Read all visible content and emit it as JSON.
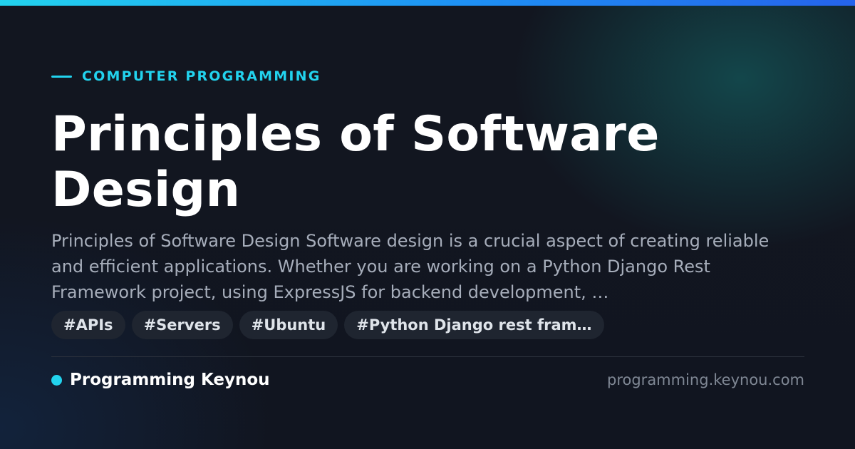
{
  "colors": {
    "background": "#121620",
    "accent": "#22d3ee",
    "accent_blue": "#2563eb",
    "title": "#ffffff",
    "description": "#a6adba",
    "tag_bg": "#1f2530",
    "tag_text": "#dfe4ea",
    "domain": "#7f8794"
  },
  "eyebrow": {
    "label": "COMPUTER PROGRAMMING"
  },
  "title": "Principles of Software Design",
  "description": "Principles of Software Design Software design is a crucial aspect of creating reliable and efficient applications. Whether you are working on a Python Django Rest Framework project, using ExpressJS for backend development, …",
  "tags": [
    "#APIs",
    "#Servers",
    "#Ubuntu",
    "#Python Django rest fram…"
  ],
  "footer": {
    "brand_icon": "dot-icon",
    "brand_name": "Programming Keynou",
    "domain": "programming.keynou.com"
  }
}
